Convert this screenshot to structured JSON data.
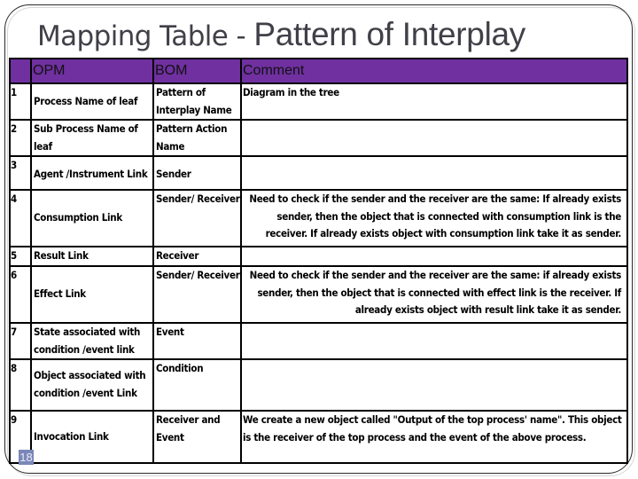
{
  "slide": {
    "title_part1": "Mapping Table - ",
    "title_part2": "Pattern of Interplay",
    "page_number": "18"
  },
  "table": {
    "headers": [
      "",
      "OPM",
      "BOM",
      "Comment"
    ],
    "rows": [
      {
        "num": "1",
        "opm": "Process Name of leaf",
        "bom": "Pattern of Interplay Name",
        "comment": "Diagram in the tree"
      },
      {
        "num": "2",
        "opm": "Sub Process Name of leaf",
        "bom": "Pattern Action Name",
        "comment": ""
      },
      {
        "num": "3",
        "opm": "Agent /Instrument Link",
        "bom": "Sender",
        "comment": ""
      },
      {
        "num": "4",
        "opm": "Consumption Link",
        "bom": "Sender/ Receiver",
        "comment": "Need to check if the sender and the receiver are the same: If already exists sender, then the object that is connected with consumption link is the receiver.  If already exists object with consumption link take it as sender."
      },
      {
        "num": "5",
        "opm": "Result Link",
        "bom": "Receiver",
        "comment": ""
      },
      {
        "num": "6",
        "opm": "Effect Link",
        "bom": "Sender/ Receiver",
        "comment": "Need to check if the sender and the receiver are the same: if already exists sender, then the object that is connected with effect link is the receiver. If already exists object with result link take it as sender."
      },
      {
        "num": "7",
        "opm": "State associated with condition /event link",
        "bom": "Event",
        "comment": ""
      },
      {
        "num": "8",
        "opm": "Object associated with condition /event Link",
        "bom": "Condition",
        "comment": ""
      },
      {
        "num": "9",
        "opm": "Invocation Link",
        "bom": "Receiver and Event",
        "comment": "We create a new object called \"Output of the top process' name\". This object is the receiver of the top process and the event of the above process."
      }
    ]
  }
}
